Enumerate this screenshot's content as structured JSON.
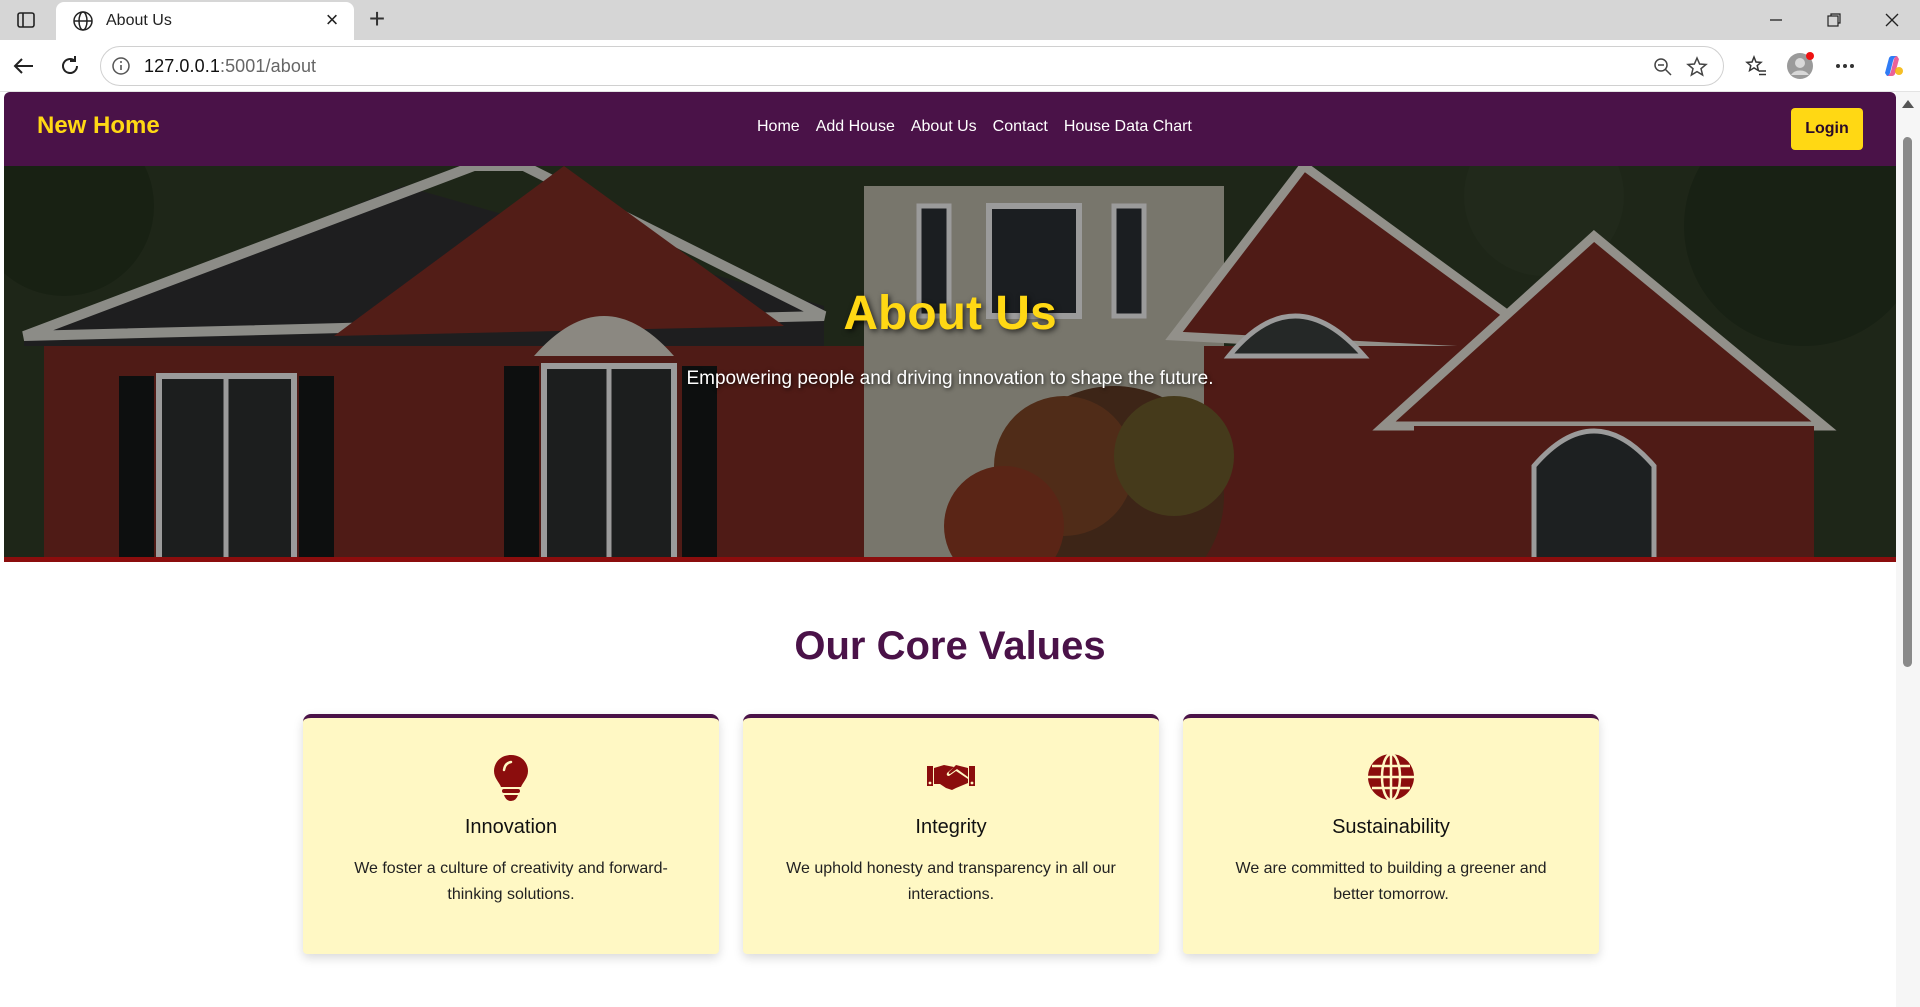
{
  "browser": {
    "tab_title": "About Us",
    "url_host": "127.0.0.1",
    "url_rest": ":5001/about"
  },
  "site": {
    "brand": "New Home",
    "nav": [
      "Home",
      "Add House",
      "About Us",
      "Contact",
      "House Data Chart"
    ],
    "login_label": "Login",
    "colors": {
      "primary": "#4a1248",
      "accent": "#ffd814",
      "card_bg": "#fff8c4",
      "icon": "#8b0d0d"
    }
  },
  "hero": {
    "title": "About Us",
    "subtitle": "Empowering people and driving innovation to shape the future."
  },
  "values": {
    "heading": "Our Core Values",
    "cards": [
      {
        "icon": "lightbulb-icon",
        "title": "Innovation",
        "text": "We foster a culture of creativity and forward-thinking solutions."
      },
      {
        "icon": "handshake-icon",
        "title": "Integrity",
        "text": "We uphold honesty and transparency in all our interactions."
      },
      {
        "icon": "globe-icon",
        "title": "Sustainability",
        "text": "We are committed to building a greener and better tomorrow."
      }
    ]
  }
}
